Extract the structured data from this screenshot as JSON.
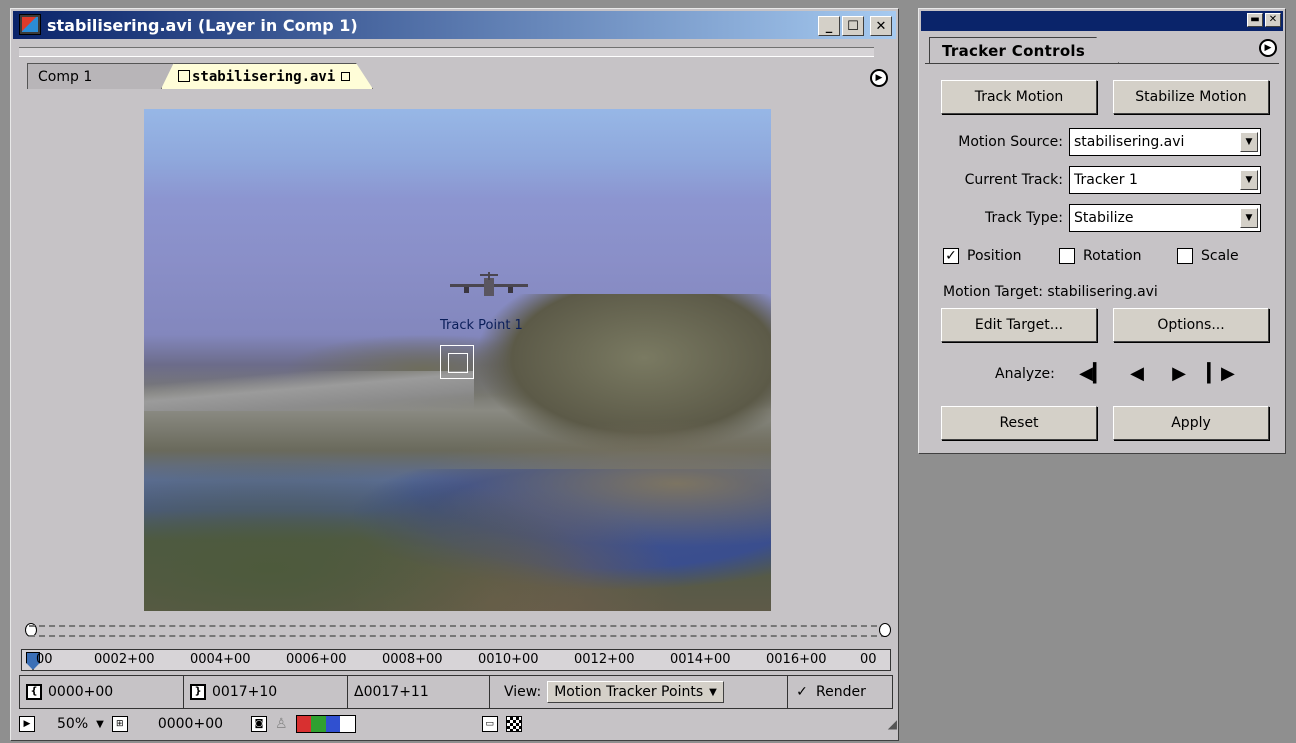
{
  "layer_window": {
    "title": "stabilisering.avi (Layer in Comp 1)",
    "window_buttons": {
      "minimize": "_",
      "maximize": "☐",
      "close": "✕"
    },
    "tabs": [
      {
        "label": "Comp 1"
      },
      {
        "label": "stabilisering.avi"
      }
    ],
    "viewer": {
      "track_point_label": "Track Point 1"
    },
    "ruler_labels": [
      "00",
      "0002+00",
      "0004+00",
      "0006+00",
      "0008+00",
      "0010+00",
      "0012+00",
      "0014+00",
      "0016+00",
      "00"
    ],
    "status": {
      "in_point": "0000+00",
      "out_point": "0017+10",
      "duration": "Δ0017+11",
      "view_label": "View:",
      "view_value": "Motion Tracker Points",
      "render_label": "Render",
      "render_checked": true
    },
    "bottom": {
      "zoom": "50%",
      "timecode": "0000+00"
    }
  },
  "tracker_controls": {
    "tab_label": "Tracker Controls",
    "track_motion_label": "Track Motion",
    "stabilize_motion_label": "Stabilize Motion",
    "motion_source_label": "Motion Source:",
    "motion_source_value": "stabilisering.avi",
    "current_track_label": "Current Track:",
    "current_track_value": "Tracker 1",
    "track_type_label": "Track Type:",
    "track_type_value": "Stabilize",
    "position_label": "Position",
    "position_checked": true,
    "rotation_label": "Rotation",
    "rotation_checked": false,
    "scale_label": "Scale",
    "scale_checked": false,
    "motion_target_text": "Motion Target:  stabilisering.avi",
    "edit_target_label": "Edit Target...",
    "options_label": "Options...",
    "analyze_label": "Analyze:",
    "reset_label": "Reset",
    "apply_label": "Apply"
  }
}
